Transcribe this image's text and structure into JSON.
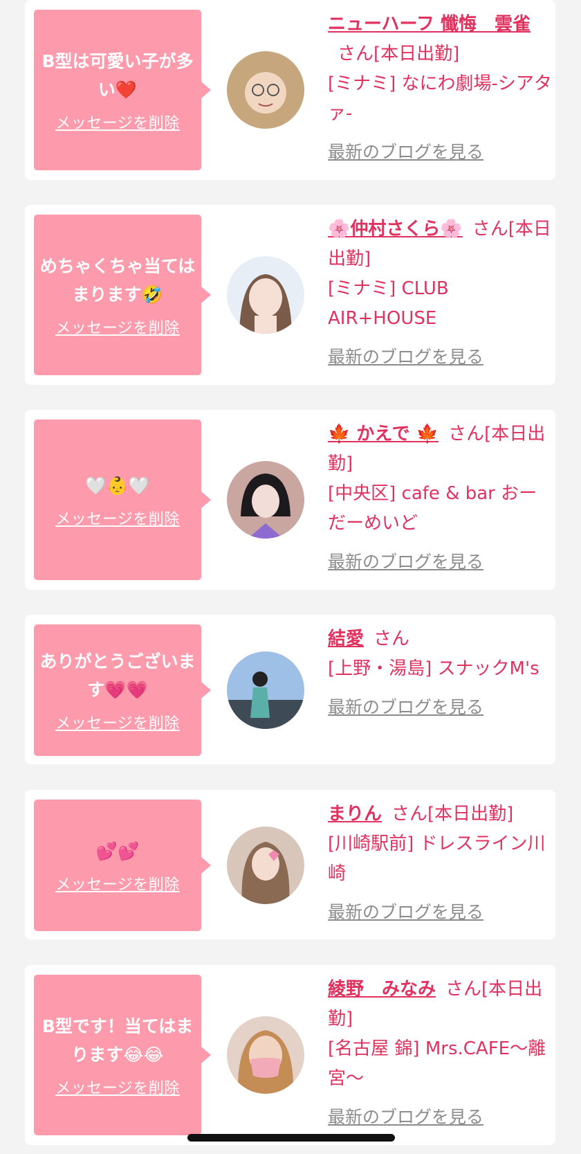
{
  "messages": [
    {
      "text": "B型は可愛い子が多い❤️",
      "delete_label": "メッセージを削除",
      "name": "ニューハーフ 懺悔　雲雀",
      "honorific": "さん[本日出勤]",
      "shop": "[ミナミ] なにわ劇場-シアタァ-",
      "blog_label": "最新のブログを見る",
      "avatar_icon": "profile-photo"
    },
    {
      "text": "めちゃくちゃ当てはまります🤣",
      "delete_label": "メッセージを削除",
      "name": "🌸仲村さくら🌸",
      "honorific": "さん[本日出勤]",
      "shop": "[ミナミ] CLUB AIR+HOUSE",
      "blog_label": "最新のブログを見る",
      "avatar_icon": "profile-photo"
    },
    {
      "text": "🤍👶🤍",
      "delete_label": "メッセージを削除",
      "name": "🍁 かえで 🍁",
      "honorific": "さん[本日出勤]",
      "shop": "[中央区] cafe & bar おーだーめいど",
      "blog_label": "最新のブログを見る",
      "avatar_icon": "profile-photo"
    },
    {
      "text": "ありがとうございます💗💗",
      "delete_label": "メッセージを削除",
      "name": "結愛",
      "honorific": "さん",
      "shop": "[上野・湯島] スナックM's",
      "blog_label": "最新のブログを見る",
      "avatar_icon": "profile-photo"
    },
    {
      "text": "💕💕",
      "delete_label": "メッセージを削除",
      "name": "まりん",
      "honorific": "さん[本日出勤]",
      "shop": "[川崎駅前] ドレスライン川崎",
      "blog_label": "最新のブログを見る",
      "avatar_icon": "profile-photo"
    },
    {
      "text": "B型です！当てはまります😂😂",
      "delete_label": "メッセージを削除",
      "name": "綾野　みなみ",
      "honorific": "さん[本日出勤]",
      "shop": "[名古屋 錦] Mrs.CAFE～離宮～",
      "blog_label": "最新のブログを見る",
      "avatar_icon": "profile-photo"
    }
  ],
  "colors": {
    "page_bg": "#f3f3f3",
    "bubble": "#fd9aab",
    "accent_text": "#e0315f",
    "link_gray": "#8c8c8c"
  }
}
